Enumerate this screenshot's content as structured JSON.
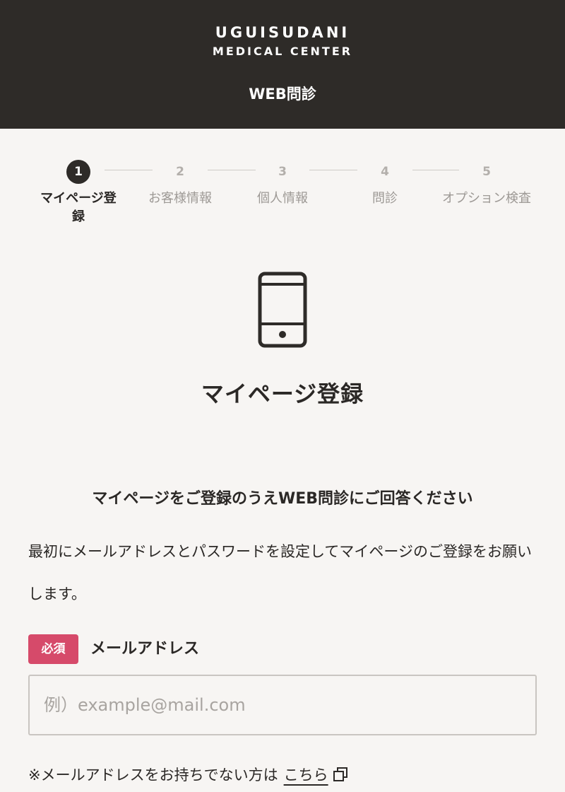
{
  "header": {
    "logo_line1": "UGUISUDANI",
    "logo_line2": "MEDICAL CENTER",
    "title": "WEB問診"
  },
  "steps": [
    {
      "number": "1",
      "label": "マイページ登録",
      "active": true
    },
    {
      "number": "2",
      "label": "お客様情報",
      "active": false
    },
    {
      "number": "3",
      "label": "個人情報",
      "active": false
    },
    {
      "number": "4",
      "label": "問診",
      "active": false
    },
    {
      "number": "5",
      "label": "オプション検査",
      "active": false
    }
  ],
  "main": {
    "icon": "smartphone-icon",
    "title": "マイページ登録",
    "lead": "マイページをご登録のうえWEB問診にご回答ください",
    "description": "最初にメールアドレスとパスワードを設定してマイページのご登録をお願いします。"
  },
  "email_field": {
    "required_badge": "必須",
    "label": "メールアドレス",
    "placeholder": "例）example@mail.com",
    "value": ""
  },
  "note": {
    "text": "※メールアドレスをお持ちでない方は",
    "link_label": "こちら",
    "link_icon": "external-window-icon"
  },
  "colors": {
    "header_bg": "#2e2b28",
    "page_bg": "#f7f5f3",
    "required_badge": "#d64a6a",
    "inactive_step": "#b3afab"
  }
}
